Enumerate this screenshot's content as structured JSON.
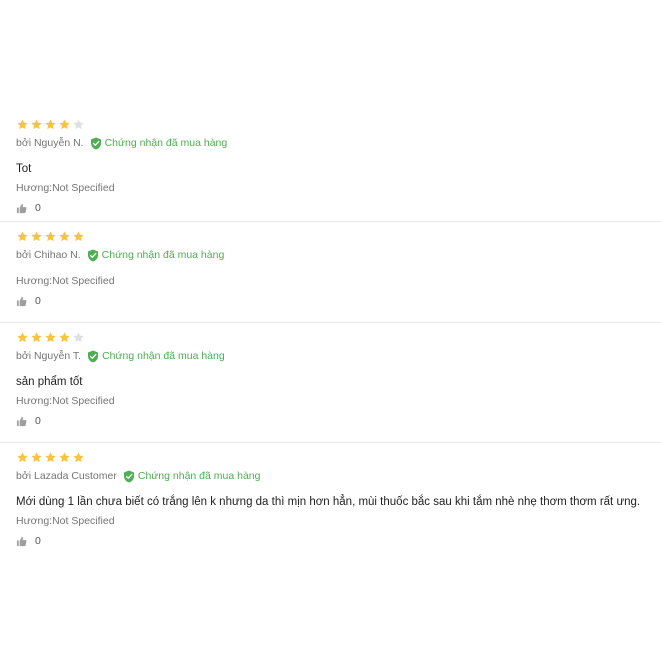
{
  "colors": {
    "star_filled": "#f7c343",
    "star_empty": "#e0e0e0",
    "verified": "#4caf50",
    "divider": "#e8e8e8"
  },
  "reviews": [
    {
      "rating": 4,
      "author": "bởi Nguyễn N.",
      "verified": "Chứng nhận đã mua hàng",
      "content": "Tot",
      "sku": "Hương:Not Specified",
      "likes": "0"
    },
    {
      "rating": 5,
      "author": "bởi Chihao N.",
      "verified": "Chứng nhận đã mua hàng",
      "content": "",
      "sku": "Hương:Not Specified",
      "likes": "0"
    },
    {
      "rating": 4,
      "author": "bởi Nguyễn T.",
      "verified": "Chứng nhận đã mua hàng",
      "content": "sản phẩm tốt",
      "sku": "Hương:Not Specified",
      "likes": "0"
    },
    {
      "rating": 5,
      "author": "bởi Lazada Customer",
      "verified": "Chứng nhận đã mua hàng",
      "content": "Mới dùng 1 lần chưa biết có trắng lên k nhưng da thì mịn hơn hẳn, mùi thuốc bắc sau khi tắm nhè nhẹ thơm thơm rất ưng.",
      "sku": "Hương:Not Specified",
      "likes": "0"
    }
  ]
}
